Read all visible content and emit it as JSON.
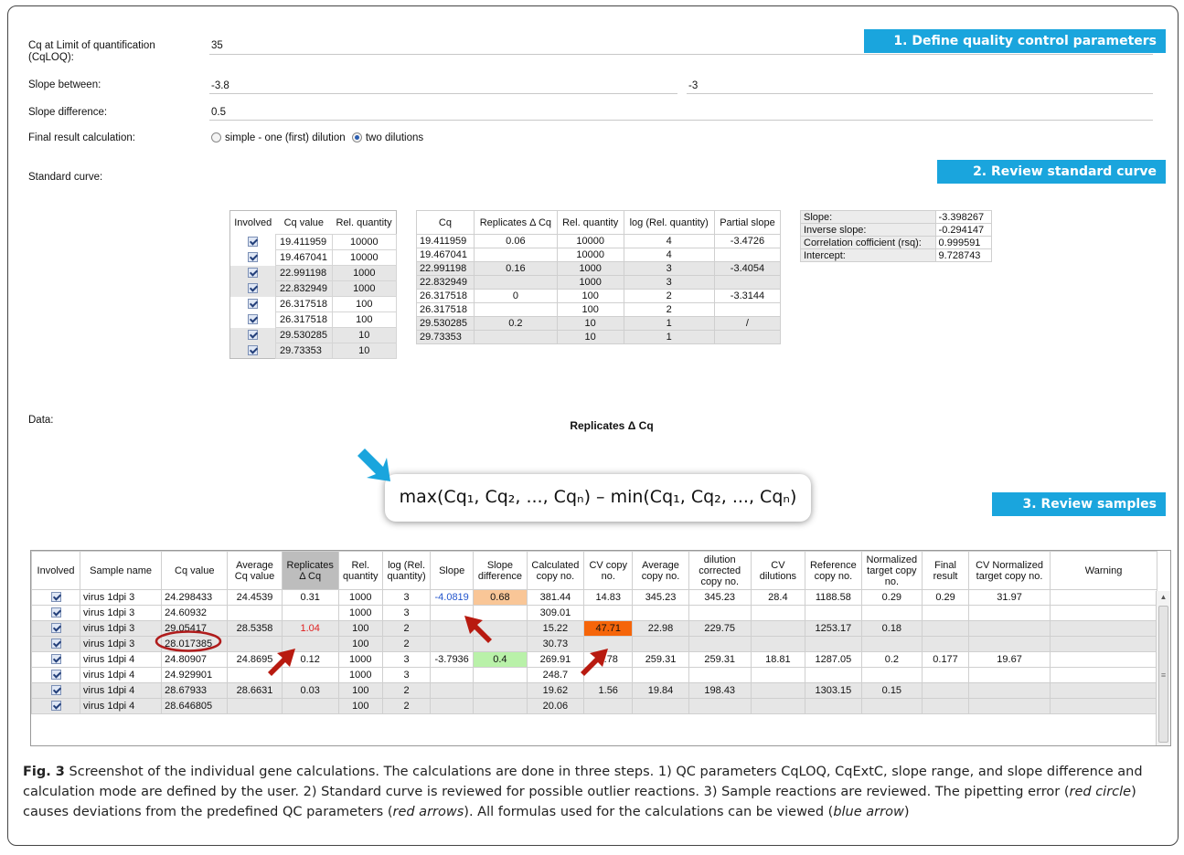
{
  "qc": {
    "cqloq_label": "Cq at Limit of quantification (CqLOQ):",
    "cqloq_value": "35",
    "slope_label": "Slope between:",
    "slope_min": "-3.8",
    "slope_max": "-3",
    "slope_diff_label": "Slope difference:",
    "slope_diff_value": "0.5",
    "final_label": "Final result calculation:",
    "option_simple": "simple - one (first) dilution",
    "option_two": "two dilutions",
    "selected_option": "two dilutions",
    "standard_curve_label": "Standard curve:",
    "data_label": "Data:"
  },
  "banners": {
    "step1": "1. Define quality control parameters",
    "step2": "2. Review standard curve",
    "step3": "3. Review samples",
    "color": "#1aa5dd"
  },
  "std_table": {
    "headers": [
      "Involved",
      "Cq value",
      "Rel. quantity"
    ],
    "rows": [
      [
        "19.411959",
        "10000"
      ],
      [
        "19.467041",
        "10000"
      ],
      [
        "22.991198",
        "1000"
      ],
      [
        "22.832949",
        "1000"
      ],
      [
        "26.317518",
        "100"
      ],
      [
        "26.317518",
        "100"
      ],
      [
        "29.530285",
        "10"
      ],
      [
        "29.73353",
        "10"
      ]
    ]
  },
  "calc_table": {
    "headers": [
      "Cq",
      "Replicates Δ Cq",
      "Rel. quantity",
      "log (Rel. quantity)",
      "Partial slope"
    ],
    "rows": [
      [
        "19.411959",
        "0.06",
        "10000",
        "4",
        "-3.4726"
      ],
      [
        "19.467041",
        "",
        "10000",
        "4",
        ""
      ],
      [
        "22.991198",
        "0.16",
        "1000",
        "3",
        "-3.4054"
      ],
      [
        "22.832949",
        "",
        "1000",
        "3",
        ""
      ],
      [
        "26.317518",
        "0",
        "100",
        "2",
        "-3.3144"
      ],
      [
        "26.317518",
        "",
        "100",
        "2",
        ""
      ],
      [
        "29.530285",
        "0.2",
        "10",
        "1",
        "/"
      ],
      [
        "29.73353",
        "",
        "10",
        "1",
        ""
      ]
    ]
  },
  "summary": {
    "rows": [
      [
        "Slope:",
        "-3.398267"
      ],
      [
        "Inverse slope:",
        "-0.294147"
      ],
      [
        "Correlation cofficient (rsq):",
        "0.999591"
      ],
      [
        "Intercept:",
        "9.728743"
      ]
    ]
  },
  "formula": {
    "title": "Replicates Δ Cq",
    "expression": "max(Cq₁, Cq₂, ..., Cqₙ) – min(Cq₁, Cq₂, ..., Cqₙ)"
  },
  "samples": {
    "headers": [
      "Involved",
      "Sample name",
      "Cq value",
      "Average Cq value",
      "Replicates Δ Cq",
      "Rel. quantity",
      "log (Rel. quantity)",
      "Slope",
      "Slope difference",
      "Calculated copy no.",
      "CV copy no.",
      "Average copy no.",
      "dilution corrected copy no.",
      "CV dilutions",
      "Reference copy no.",
      "Normalized target copy no.",
      "Final result",
      "CV Normalized target copy no.",
      "Warning"
    ],
    "rows": [
      [
        "virus 1dpi 3",
        "24.298433",
        "24.4539",
        "0.31",
        "1000",
        "3",
        "-4.0819",
        "0.68",
        "381.44",
        "14.83",
        "345.23",
        "345.23",
        "28.4",
        "1188.58",
        "0.29",
        "0.29",
        "31.97",
        ""
      ],
      [
        "virus 1dpi 3",
        "24.60932",
        "",
        "",
        "1000",
        "3",
        "",
        "",
        "309.01",
        "",
        "",
        "",
        "",
        "",
        "",
        "",
        "",
        ""
      ],
      [
        "virus 1dpi 3",
        "29.05417",
        "28.5358",
        "1.04",
        "100",
        "2",
        "",
        "",
        "15.22",
        "47.71",
        "22.98",
        "229.75",
        "",
        "1253.17",
        "0.18",
        "",
        "",
        ""
      ],
      [
        "virus 1dpi 3",
        "28.017385",
        "",
        "",
        "100",
        "2",
        "",
        "",
        "30.73",
        "",
        "",
        "",
        "",
        "",
        "",
        "",
        "",
        ""
      ],
      [
        "virus 1dpi 4",
        "24.80907",
        "24.8695",
        "0.12",
        "1000",
        "3",
        "-3.7936",
        "0.4",
        "269.91",
        "5.78",
        "259.31",
        "259.31",
        "18.81",
        "1287.05",
        "0.2",
        "0.177",
        "19.67",
        ""
      ],
      [
        "virus 1dpi 4",
        "24.929901",
        "",
        "",
        "1000",
        "3",
        "",
        "",
        "248.7",
        "",
        "",
        "",
        "",
        "",
        "",
        "",
        "",
        ""
      ],
      [
        "virus 1dpi 4",
        "28.67933",
        "28.6631",
        "0.03",
        "100",
        "2",
        "",
        "",
        "19.62",
        "1.56",
        "19.84",
        "198.43",
        "",
        "1303.15",
        "0.15",
        "",
        "",
        ""
      ],
      [
        "virus 1dpi 4",
        "28.646805",
        "",
        "",
        "100",
        "2",
        "",
        "",
        "20.06",
        "",
        "",
        "",
        "",
        "",
        "",
        "",
        "",
        ""
      ]
    ],
    "highlight_colors": {
      "slope_diff_bad": "#f9c697",
      "slope_diff_ok": "#b9f1a9",
      "cv_bad": "#f5650a",
      "slope_bad_text": "#2255cc",
      "delta_bad_text": "#e02020",
      "circle": "#b01c1c",
      "arrow_red": "#b81a10",
      "arrow_blue": "#1aa5dd"
    }
  },
  "caption": {
    "fig": "Fig. 3",
    "text": " Screenshot of the individual gene calculations. The calculations are done in three steps. 1) QC parameters CqLOQ, CqExtC, slope range, and slope difference and calculation mode are defined by the user. 2) Standard curve is reviewed for possible outlier reactions. 3) Sample reactions are reviewed. The pipetting error (",
    "red_circle": "red circle",
    "mid1": ") causes deviations from the predefined QC parameters (",
    "red_arrows": "red arrows",
    "mid2": "). All formulas used for the calculations can be viewed (",
    "blue_arrow": "blue arrow",
    "end": ")"
  }
}
